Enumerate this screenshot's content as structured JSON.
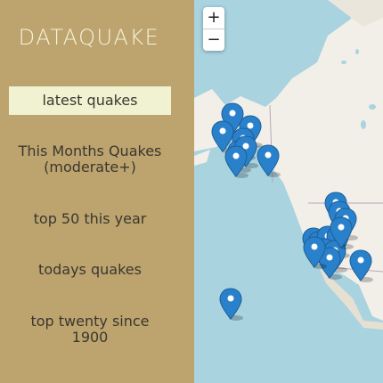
{
  "app": {
    "title": "DATAQUAKE"
  },
  "sidebar": {
    "items": [
      {
        "label": "latest quakes",
        "active": true
      },
      {
        "label": "This Months Quakes (moderate+)",
        "active": false
      },
      {
        "label": "top 50 this year",
        "active": false
      },
      {
        "label": "todays quakes",
        "active": false
      },
      {
        "label": "top twenty since 1900",
        "active": false
      }
    ]
  },
  "map": {
    "zoom_in_label": "+",
    "zoom_out_label": "−",
    "colors": {
      "water": "#a9d3df",
      "land": "#f2efe9",
      "marker": "#2a81cb"
    },
    "marker_icon": "map-pin-icon",
    "marker_count": 22
  }
}
